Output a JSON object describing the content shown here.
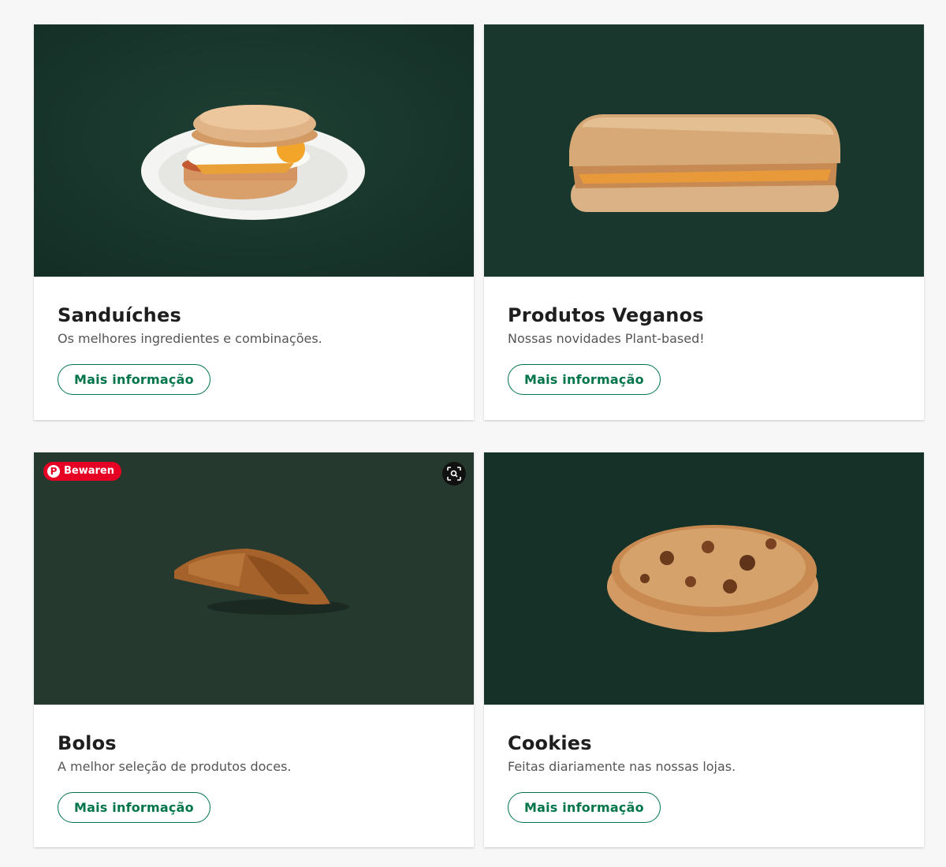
{
  "cards": [
    {
      "title": "Sanduíches",
      "subtitle": "Os melhores ingredientes e combinações.",
      "button_label": "Mais informação",
      "image_icon": "sandwich-on-plate-image",
      "bg_color": "#1b3a30"
    },
    {
      "title": "Produtos Veganos",
      "subtitle": "Nossas novidades Plant-based!",
      "button_label": "Mais informação",
      "image_icon": "vegan-panini-image",
      "bg_color": "#1c3a2f"
    },
    {
      "title": "Bolos",
      "subtitle": "A melhor seleção de produtos doces.",
      "button_label": "Mais informação",
      "image_icon": "croissant-image",
      "bg_color": "#26392f",
      "overlay": {
        "pinterest_label": "Bewaren",
        "pinterest_icon": "pinterest-icon",
        "lens_icon": "visual-search-icon"
      }
    },
    {
      "title": "Cookies",
      "subtitle": "Feitas diariamente nas nossas lojas.",
      "button_label": "Mais informação",
      "image_icon": "cookie-image",
      "bg_color": "#163128"
    }
  ],
  "colors": {
    "accent": "#00754a",
    "page_bg": "#f7f7f7",
    "pinterest_red": "#e60023"
  }
}
